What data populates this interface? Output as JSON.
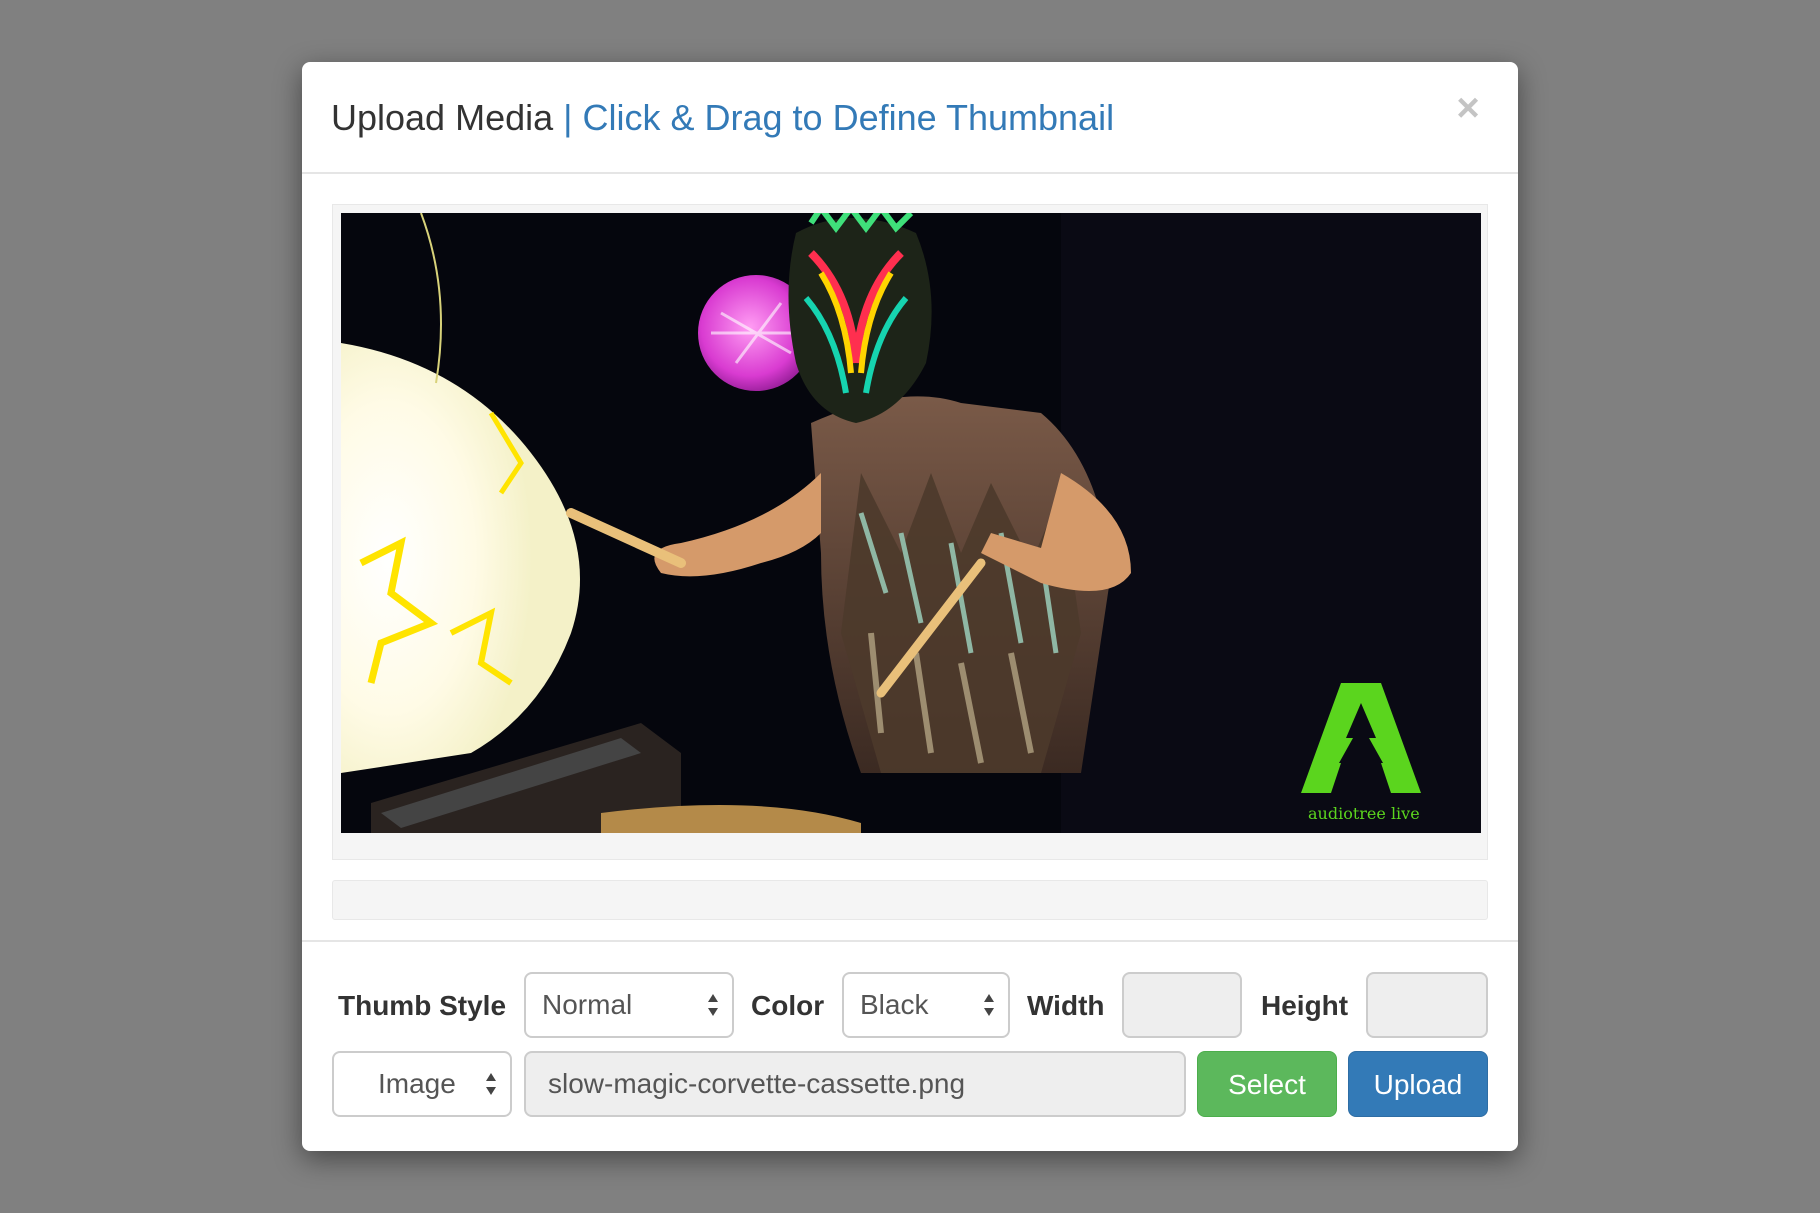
{
  "modal": {
    "title": "Upload Media",
    "subtitle": "| Click & Drag to Define Thumbnail",
    "close_symbol": "×"
  },
  "preview": {
    "watermark_text": "audiotree live",
    "watermark_color": "#5bd51e"
  },
  "form": {
    "thumb_style_label": "Thumb Style",
    "thumb_style_value": "Normal",
    "color_label": "Color",
    "color_value": "Black",
    "width_label": "Width",
    "width_value": "",
    "height_label": "Height",
    "height_value": "",
    "media_type_value": "Image",
    "file_name": "slow-magic-corvette-cassette.png",
    "select_label": "Select",
    "upload_label": "Upload"
  },
  "colors": {
    "accent_blue": "#337ab7",
    "select_green": "#5cb85c",
    "backdrop": "#808080"
  }
}
